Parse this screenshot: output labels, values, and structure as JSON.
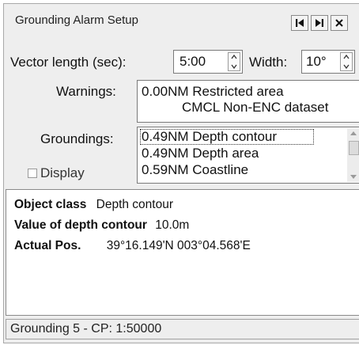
{
  "window": {
    "title": "Grounding Alarm Setup"
  },
  "title_buttons": [
    {
      "icon": "first-page-icon"
    },
    {
      "icon": "last-page-icon"
    },
    {
      "icon": "close-icon"
    }
  ],
  "vector": {
    "label": "Vector length (sec):",
    "value": "5:00"
  },
  "width": {
    "label": "Width:",
    "value": "10°"
  },
  "warnings": {
    "label": "Warnings:",
    "items": [
      "0.00NM Restricted area",
      "CMCL Non-ENC dataset"
    ]
  },
  "groundings": {
    "label": "Groundings:",
    "items": [
      "0.49NM Depth contour",
      "0.49NM Depth area",
      "0.59NM Coastline"
    ],
    "selected_index": 0
  },
  "display": {
    "label": "Display",
    "checked": false
  },
  "info": {
    "object_class_label": "Object class",
    "object_class_value": "Depth contour",
    "value_label": "Value of depth contour",
    "value_value": "10.0m",
    "pos_label": "Actual Pos.",
    "pos_value": "39°16.149'N 003°04.568'E"
  },
  "status": {
    "text": "Grounding 5 - CP: 1:50000"
  }
}
